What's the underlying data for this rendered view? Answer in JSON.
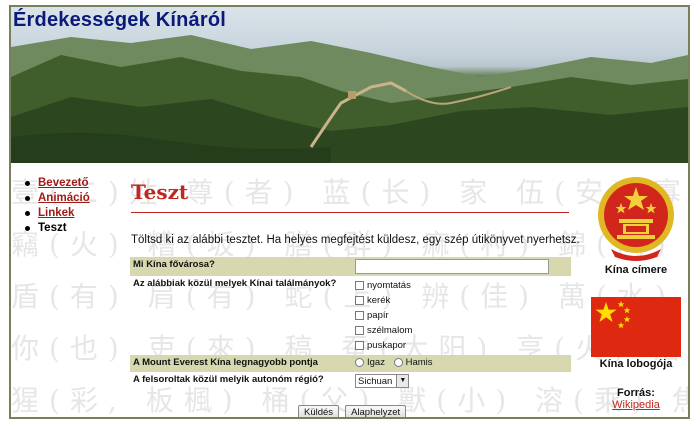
{
  "header": {
    "title": "Érdekességek Kínáról"
  },
  "nav": {
    "items": [
      {
        "label": "Bevezető",
        "link": true
      },
      {
        "label": "Animáció",
        "link": true
      },
      {
        "label": "Linkek",
        "link": true
      },
      {
        "label": "Teszt",
        "link": false
      }
    ]
  },
  "main": {
    "heading": "Teszt",
    "intro": "Töltsd ki az alábbi tesztet. Ha helyes megfejtést küldesz, egy szép útikönyvet nyerhetsz.",
    "q1": {
      "label": "Mi Kína fővárosa?",
      "value": ""
    },
    "q2": {
      "label": "Az alábbiak közül melyek Kínai találmányok?",
      "options": [
        "nyomtatás",
        "kerék",
        "papír",
        "szélmalom",
        "puskapor"
      ]
    },
    "q3": {
      "label": "A Mount Everest Kína legnagyobb pontja",
      "options": [
        "Igaz",
        "Hamis"
      ]
    },
    "q4": {
      "label": "A felsoroltak közül melyik autonóm régió?",
      "selected": "Sichuan"
    },
    "submit_label": "Küldés",
    "reset_label": "Alaphelyzet"
  },
  "side": {
    "emblem_caption": "Kína címere",
    "flag_caption": "Kína lobogója",
    "source_label": "Forrás:",
    "source_link": "Wikipedia"
  },
  "colors": {
    "accent": "#c0271f",
    "title": "#0b1a78",
    "highlight": "#d8d8b0",
    "flag": "#de2910"
  }
}
